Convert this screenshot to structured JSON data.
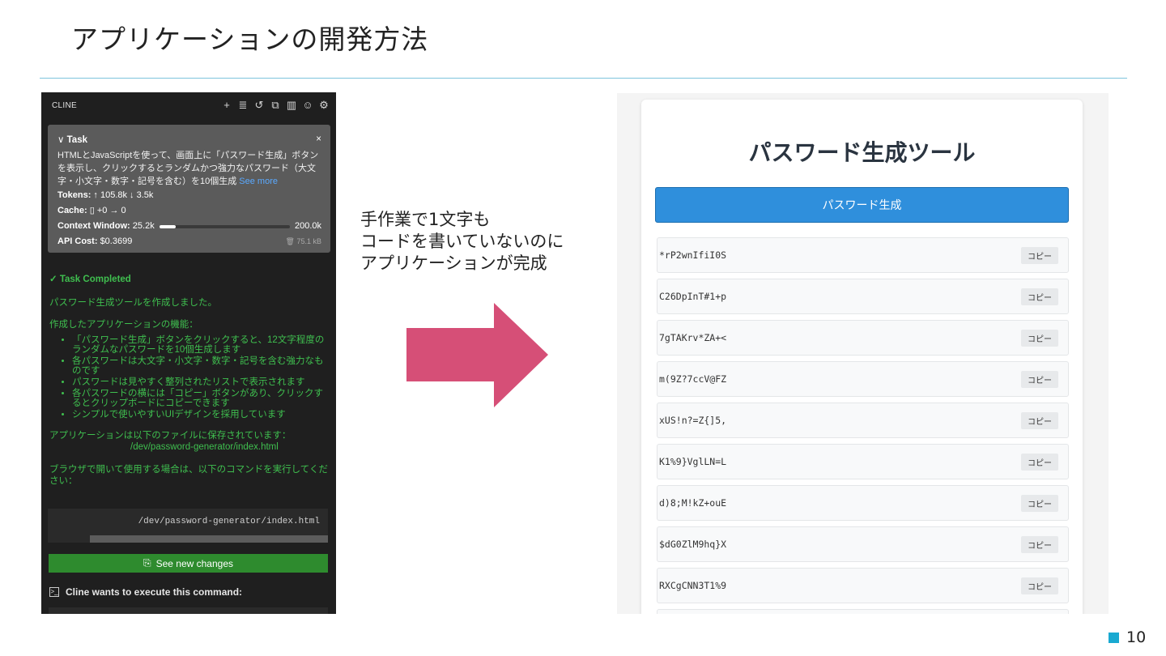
{
  "slide": {
    "title": "アプリケーションの開発方法",
    "caption_lines": [
      "手作業で1文字も",
      "コードを書いていないのに",
      "アプリケーションが完成"
    ],
    "page_number": "10",
    "colors": {
      "rule": "#7ec4dc",
      "arrow": "#d64f77",
      "page_square": "#19a9d1"
    }
  },
  "cline": {
    "name": "CLINE",
    "header_icons": [
      "plus-icon",
      "server-icon",
      "history-icon",
      "popout-icon",
      "book-icon",
      "account-icon",
      "gear-icon"
    ],
    "task": {
      "label": "Task",
      "description": "HTMLとJavaScriptを使って、画面上に「パスワード生成」ボタンを表示し、クリックするとランダムかつ強力なパスワード（大文字・小文字・数字・記号を含む）を10個生成",
      "see_more": "See more",
      "tokens_label": "Tokens:",
      "tokens_value": "↑ 105.8k ↓ 3.5k",
      "cache_label": "Cache:",
      "cache_value": "+0 → 0",
      "context_label": "Context Window:",
      "context_used": "25.2k",
      "context_max": "200.0k",
      "context_fraction": 0.126,
      "cost_label": "API Cost:",
      "cost_value": "$0.3699",
      "size": "75.1 kB"
    },
    "completed": {
      "title": "Task Completed",
      "intro": "パスワード生成ツールを作成しました。",
      "features_heading": "作成したアプリケーションの機能：",
      "features": [
        "「パスワード生成」ボタンをクリックすると、12文字程度のランダムなパスワードを10個生成します",
        "各パスワードは大文字・小文字・数字・記号を含む強力なものです",
        "パスワードは見やすく整列されたリストで表示されます",
        "各パスワードの横には「コピー」ボタンがあり、クリックするとクリップボードにコピーできます",
        "シンプルで使いやすいUIデザインを採用しています"
      ],
      "saved_text": "アプリケーションは以下のファイルに保存されています：",
      "saved_path": "/dev/password-generator/index.html",
      "open_text": "ブラウザで開いて使用する場合は、以下のコマンドを実行してください：",
      "command": "/dev/password-generator/index.html"
    },
    "see_changes": "See new changes",
    "execute_label": "Cline wants to execute this command:",
    "colors": {
      "bg": "#1f1f1f",
      "task_bg": "#5b5b5b",
      "green": "#3fbf4f",
      "button": "#2e8b2e",
      "link": "#5aa9ff"
    }
  },
  "app": {
    "title": "パスワード生成ツール",
    "generate_label": "パスワード生成",
    "copy_label": "コピー",
    "passwords": [
      "*rP2wnIfiI0S",
      "C26DpInT#1+p",
      "7gTAKrv*ZA+<",
      "m(9Z?7ccV@FZ",
      "xUS!n?=Z{]5,",
      "K1%9}VglLN=L",
      "d)8;M!kZ+ouE",
      "$dG0ZlM9hq}X",
      "RXCgCNN3T1%9",
      ""
    ],
    "colors": {
      "button": "#2f8fdc",
      "title": "#2a3440"
    }
  }
}
